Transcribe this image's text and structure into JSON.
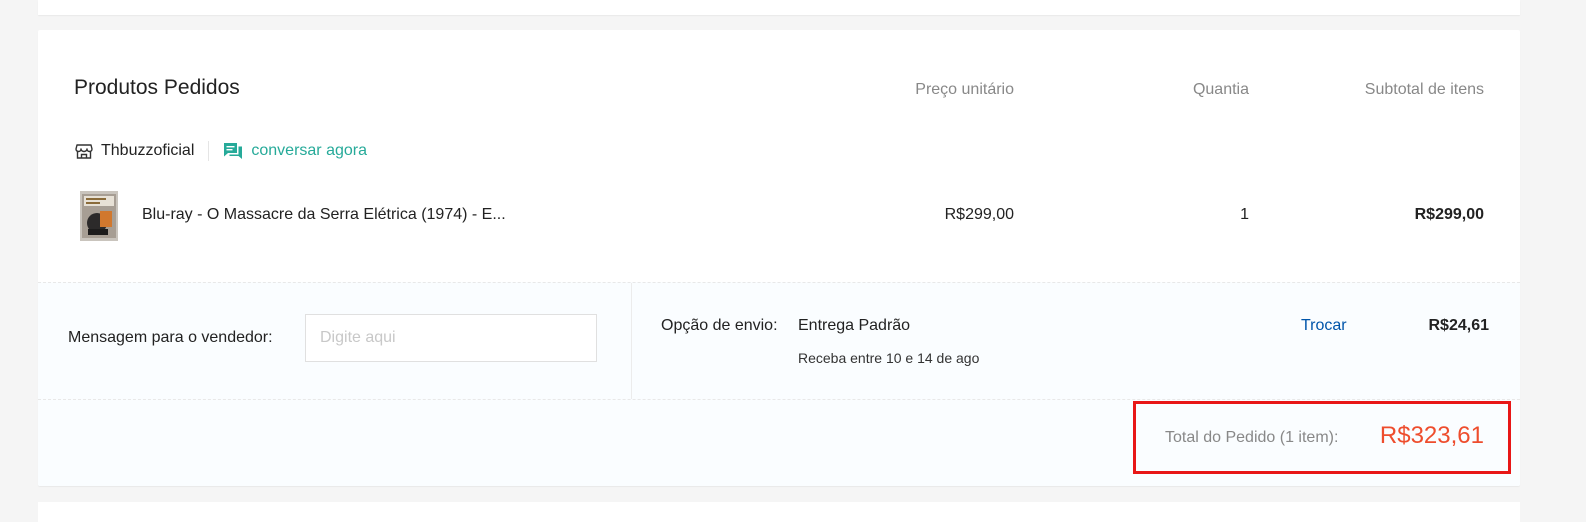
{
  "order": {
    "title": "Produtos Pedidos",
    "columns": {
      "unit_price": "Preço unitário",
      "quantity": "Quantia",
      "subtotal": "Subtotal de itens"
    },
    "shop": {
      "name": "Thbuzzoficial",
      "chat_label": "conversar agora",
      "icons": [
        "store-icon",
        "chat-icon"
      ]
    },
    "items": [
      {
        "name": "Blu-ray - O Massacre da Serra Elétrica (1974) - E...",
        "unit_price": "R$299,00",
        "quantity": "1",
        "subtotal": "R$299,00"
      }
    ]
  },
  "message": {
    "label": "Mensagem para o vendedor:",
    "placeholder": "Digite aqui",
    "value": ""
  },
  "shipping": {
    "label": "Opção de envio:",
    "method": "Entrega Padrão",
    "eta": "Receba entre 10 e 14 de ago",
    "change_label": "Trocar",
    "price": "R$24,61"
  },
  "total": {
    "label": "Total do Pedido (1 item):",
    "value": "R$323,61"
  },
  "colors": {
    "accent_teal": "#26aa99",
    "link_blue": "#0055aa",
    "price_orange": "#ee4d2d",
    "highlight_red": "#e81717"
  }
}
